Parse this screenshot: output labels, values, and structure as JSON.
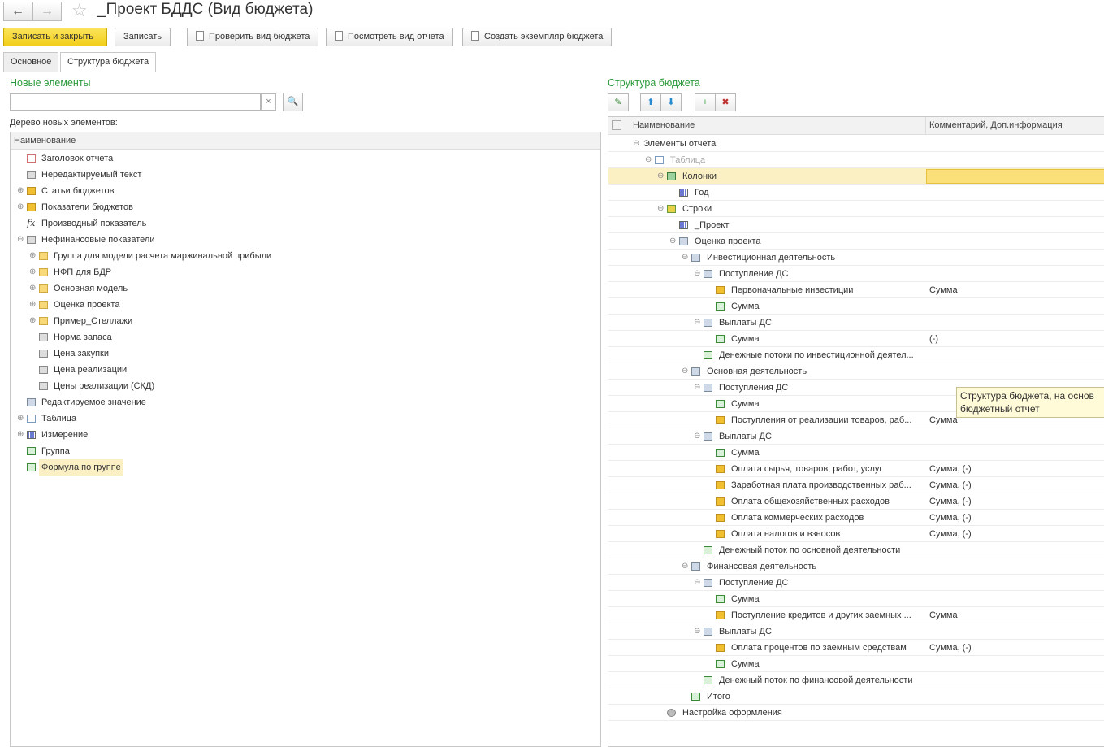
{
  "window": {
    "title": "_Проект БДДС (Вид бюджета)",
    "back": "←",
    "forward": "→",
    "star": "☆"
  },
  "toolbar": {
    "save_close": "Записать и закрыть",
    "save": "Записать",
    "check": "Проверить вид бюджета",
    "view_report": "Посмотреть вид отчета",
    "create_instance": "Создать экземпляр бюджета"
  },
  "tabs": [
    "Основное",
    "Структура бюджета"
  ],
  "left": {
    "title": "Новые элементы",
    "search_value": "",
    "clear": "×",
    "tree_label": "Дерево новых элементов:",
    "column": "Наименование",
    "items": [
      {
        "level": 0,
        "icon": "report",
        "label": "Заголовок отчета"
      },
      {
        "level": 0,
        "icon": "text",
        "label": "Нередактируемый текст"
      },
      {
        "level": 0,
        "icon": "article",
        "label": "Статьи бюджетов",
        "exp": "+"
      },
      {
        "level": 0,
        "icon": "article",
        "label": "Показатели бюджетов",
        "exp": "+"
      },
      {
        "level": 0,
        "icon": "fx",
        "label": "Производный показатель"
      },
      {
        "level": 0,
        "icon": "text",
        "label": "Нефинансовые показатели",
        "exp": "−"
      },
      {
        "level": 1,
        "icon": "folder",
        "label": "Группа для модели расчета маржинальной прибыли",
        "exp": "+"
      },
      {
        "level": 1,
        "icon": "folder",
        "label": "НФП для БДР",
        "exp": "+"
      },
      {
        "level": 1,
        "icon": "folder",
        "label": "Основная модель",
        "exp": "+"
      },
      {
        "level": 1,
        "icon": "folder",
        "label": "Оценка проекта",
        "exp": "+"
      },
      {
        "level": 1,
        "icon": "folder",
        "label": "Пример_Стеллажи",
        "exp": "+"
      },
      {
        "level": 1,
        "icon": "text",
        "label": "Норма запаса"
      },
      {
        "level": 1,
        "icon": "text",
        "label": "Цена закупки"
      },
      {
        "level": 1,
        "icon": "text",
        "label": "Цена реализации"
      },
      {
        "level": 1,
        "icon": "text",
        "label": "Цены реализации (СКД)"
      },
      {
        "level": 0,
        "icon": "editval",
        "label": "Редактируемое значение"
      },
      {
        "level": 0,
        "icon": "table",
        "label": "Таблица",
        "exp": "+"
      },
      {
        "level": 0,
        "icon": "dim",
        "label": "Измерение",
        "exp": "+"
      },
      {
        "level": 0,
        "icon": "formula",
        "label": "Группа"
      },
      {
        "level": 0,
        "icon": "formula",
        "label": "Формула по группе",
        "selected": true
      }
    ]
  },
  "right": {
    "title": "Структура бюджета",
    "columns": [
      "Наименование",
      "Комментарий, Доп.информация"
    ],
    "items": [
      {
        "level": 0,
        "label": "Элементы отчета",
        "exp": "−"
      },
      {
        "level": 1,
        "icon": "table",
        "label": "Таблица",
        "exp": "−",
        "muted": true
      },
      {
        "level": 2,
        "icon": "cols",
        "label": "Колонки",
        "exp": "−",
        "selected": true
      },
      {
        "level": 3,
        "icon": "dim",
        "label": "Год"
      },
      {
        "level": 2,
        "icon": "rows",
        "label": "Строки",
        "exp": "−"
      },
      {
        "level": 3,
        "icon": "dim",
        "label": "_Проект"
      },
      {
        "level": 3,
        "icon": "editval",
        "label": "Оценка проекта",
        "exp": "−"
      },
      {
        "level": 4,
        "icon": "editval",
        "label": "Инвестиционная деятельность",
        "exp": "−"
      },
      {
        "level": 5,
        "icon": "editval",
        "label": "Поступление ДС",
        "exp": "−"
      },
      {
        "level": 6,
        "icon": "article",
        "label": "Первоначальные инвестиции",
        "comment": "Сумма"
      },
      {
        "level": 6,
        "icon": "formula",
        "label": "Сумма"
      },
      {
        "level": 5,
        "icon": "editval",
        "label": "Выплаты ДС",
        "exp": "−"
      },
      {
        "level": 6,
        "icon": "formula",
        "label": "Сумма",
        "comment": "(-)"
      },
      {
        "level": 5,
        "icon": "formula",
        "label": "Денежные потоки по инвестиционной деятел..."
      },
      {
        "level": 4,
        "icon": "editval",
        "label": "Основная деятельность",
        "exp": "−"
      },
      {
        "level": 5,
        "icon": "editval",
        "label": "Поступления ДС",
        "exp": "−"
      },
      {
        "level": 6,
        "icon": "formula",
        "label": "Сумма"
      },
      {
        "level": 6,
        "icon": "article",
        "label": "Поступления от реализации товаров, раб...",
        "comment": "Сумма"
      },
      {
        "level": 5,
        "icon": "editval",
        "label": "Выплаты ДС",
        "exp": "−"
      },
      {
        "level": 6,
        "icon": "formula",
        "label": "Сумма"
      },
      {
        "level": 6,
        "icon": "article",
        "label": "Оплата сырья, товаров, работ, услуг",
        "comment": "Сумма, (-)"
      },
      {
        "level": 6,
        "icon": "article",
        "label": "Заработная плата производственных раб...",
        "comment": "Сумма, (-)"
      },
      {
        "level": 6,
        "icon": "article",
        "label": "Оплата общехозяйственных расходов",
        "comment": "Сумма, (-)"
      },
      {
        "level": 6,
        "icon": "article",
        "label": "Оплата коммерческих расходов",
        "comment": "Сумма, (-)"
      },
      {
        "level": 6,
        "icon": "article",
        "label": "Оплата налогов и взносов",
        "comment": "Сумма, (-)"
      },
      {
        "level": 5,
        "icon": "formula",
        "label": "Денежный поток по основной деятельности"
      },
      {
        "level": 4,
        "icon": "editval",
        "label": "Финансовая деятельность",
        "exp": "−"
      },
      {
        "level": 5,
        "icon": "editval",
        "label": "Поступление ДС",
        "exp": "−"
      },
      {
        "level": 6,
        "icon": "formula",
        "label": "Сумма"
      },
      {
        "level": 6,
        "icon": "article",
        "label": "Поступление кредитов и других заемных ...",
        "comment": "Сумма"
      },
      {
        "level": 5,
        "icon": "editval",
        "label": "Выплаты ДС",
        "exp": "−"
      },
      {
        "level": 6,
        "icon": "article",
        "label": "Оплата процентов по заемным средствам",
        "comment": "Сумма, (-)"
      },
      {
        "level": 6,
        "icon": "formula",
        "label": "Сумма"
      },
      {
        "level": 5,
        "icon": "formula",
        "label": "Денежный поток по финансовой деятельности"
      },
      {
        "level": 4,
        "icon": "formula",
        "label": "Итого"
      },
      {
        "level": 2,
        "icon": "gear",
        "label": "Настройка оформления"
      }
    ],
    "tooltip": [
      "Структура бюджета, на основ",
      "бюджетный отчет"
    ]
  }
}
